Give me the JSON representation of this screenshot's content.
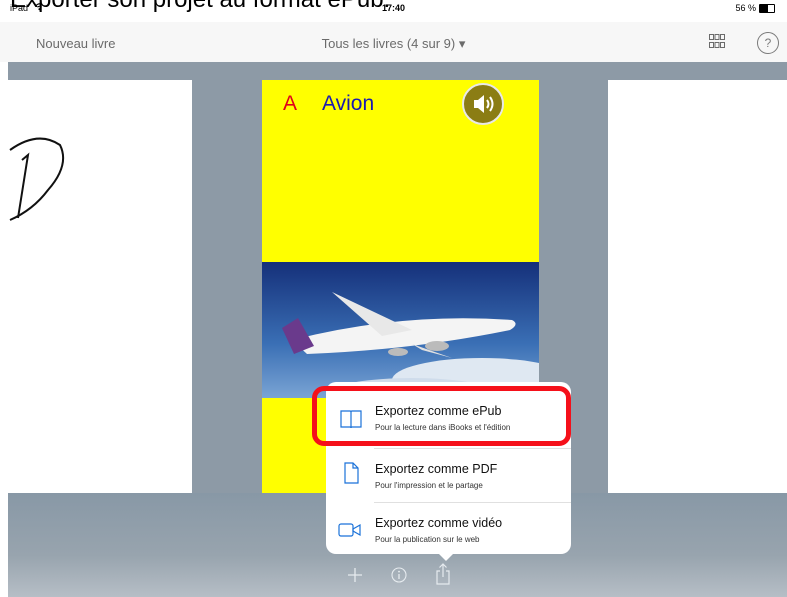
{
  "caption": "Exporter son projet au format ePub.",
  "status_bar": {
    "device": "iPad",
    "time": "17:40",
    "battery": "56 %"
  },
  "nav": {
    "left_button": "Nouveau livre",
    "title": "Tous les livres (4 sur 9) ▾",
    "help": "?"
  },
  "cover": {
    "letter": "A",
    "word": "Avion"
  },
  "export_menu": [
    {
      "title": "Exportez comme ePub",
      "subtitle": "Pour la lecture dans iBooks et l'édition",
      "icon": "book-icon"
    },
    {
      "title": "Exportez comme PDF",
      "subtitle": "Pour l'impression et le partage",
      "icon": "document-icon"
    },
    {
      "title": "Exportez comme vidéo",
      "subtitle": "Pour la publication sur le web",
      "icon": "video-camera-icon"
    }
  ],
  "toolbar": {
    "icons": [
      "plus-icon",
      "info-icon",
      "share-icon"
    ]
  },
  "colors": {
    "cover_yellow": "#ffff00",
    "highlight_red": "#f5101a",
    "sound_button": "#8b7d14",
    "stage_gray": "#8d9aa6"
  }
}
